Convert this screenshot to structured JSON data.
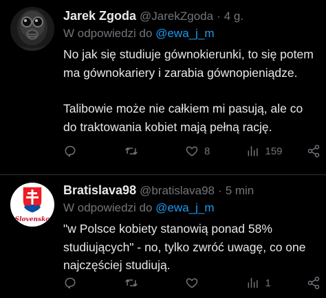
{
  "tweets": [
    {
      "author_name": "Jarek Zgoda",
      "handle": "@JarekZgoda",
      "time": "4 g.",
      "reply_prefix": "W odpowiedzi do",
      "reply_to": "@ewa_j_m",
      "paragraphs": [
        "No jak się studiuje gównokierunki, to się potem ma gównokariery i zarabia gównopieniądze.",
        "Talibowie może nie całkiem mi pasują, ale co do traktowania kobiet mają pełną rację."
      ],
      "stats": {
        "replies": "",
        "retweets": "",
        "likes": "8",
        "views": "159"
      },
      "avatar_icon": "gas-mask-avatar"
    },
    {
      "author_name": "Bratislava98",
      "handle": "@bratislava98",
      "time": "5 min",
      "reply_prefix": "W odpowiedzi do",
      "reply_to": "@ewa_j_m",
      "paragraphs": [
        "\"w Polsce kobiety stanowią ponad 58% studiujących\" - no, tylko zwróć uwagę, co one najczęściej studiują."
      ],
      "stats": {
        "replies": "",
        "retweets": "",
        "likes": "",
        "views": "1"
      },
      "avatar_icon": "slovak-coat-of-arms-avatar",
      "avatar_text": "Slovensko"
    }
  ],
  "icons": {
    "reply": "reply-icon",
    "retweet": "retweet-icon",
    "like": "heart-icon",
    "views": "views-icon",
    "share": "share-icon"
  },
  "colors": {
    "background": "#000000",
    "text": "#e7e9ea",
    "secondary": "#71767b",
    "accent": "#1d9bf0",
    "divider": "#2f3336"
  }
}
